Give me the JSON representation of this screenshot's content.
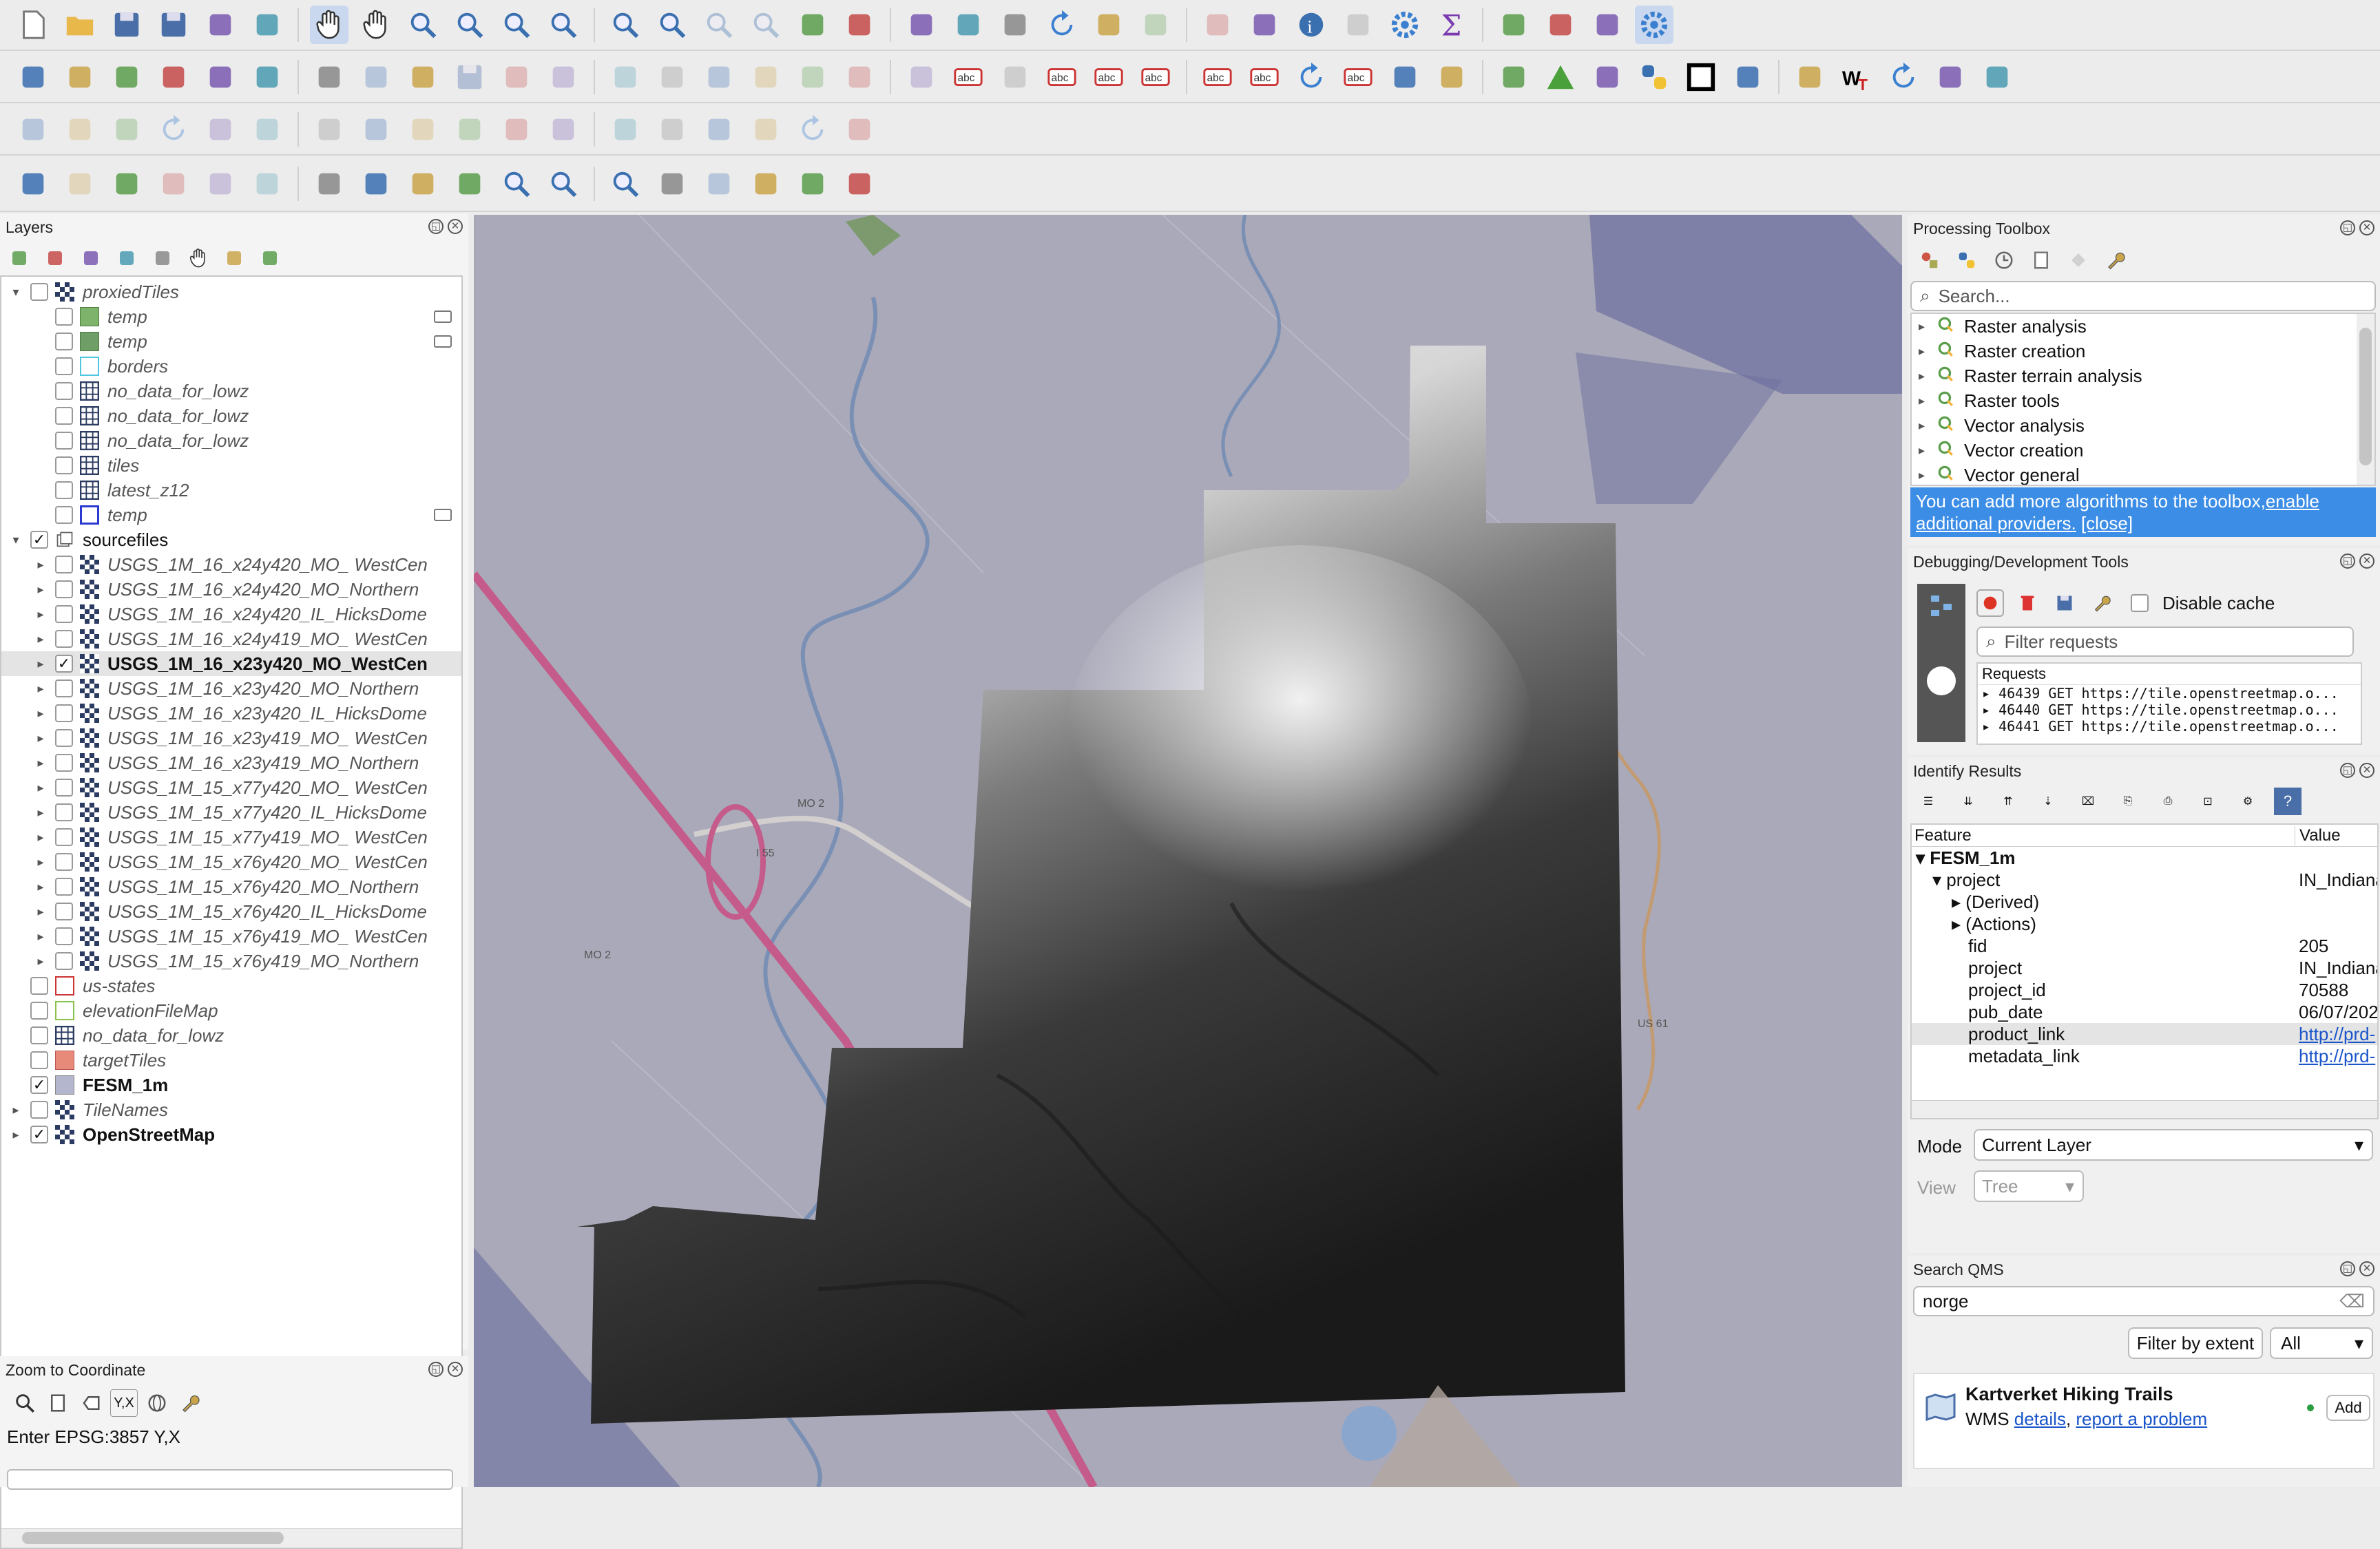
{
  "toolbars": {
    "row1": [
      "new-project-icon",
      "open-project-icon",
      "save-project-icon",
      "save-as-icon",
      "print-layout-icon",
      "style-manager-icon",
      "pan-icon",
      "pan-to-selection-icon",
      "zoom-in-icon",
      "zoom-out-icon",
      "zoom-full-icon",
      "zoom-to-selection-icon",
      "zoom-to-layer-icon",
      "zoom-native-icon",
      "zoom-last-icon",
      "zoom-next-icon",
      "new-map-view-icon",
      "new-3d-view-icon",
      "new-bookmark-icon",
      "show-bookmarks-icon",
      "temporal-controller-icon",
      "refresh-icon",
      "select-features-icon",
      "select-by-value-icon",
      "deselect-icon",
      "add-annotation-icon",
      "identify-icon",
      "attribute-table-icon",
      "processing-toolbox-icon",
      "statistics-icon",
      "field-calculator-icon",
      "measure-icon",
      "map-tips-icon",
      "settings-icon"
    ],
    "row2": [
      "data-source-manager-icon",
      "new-geopackage-icon",
      "add-vector-icon",
      "digitize-icon",
      "new-shapefile-icon",
      "add-raster-icon",
      "add-wms-icon",
      "current-edits-icon",
      "toggle-editing-icon",
      "save-edits-icon",
      "add-feature-icon",
      "vertex-tool-icon",
      "modify-attributes-icon",
      "delete-selected-icon",
      "cut-icon",
      "copy-icon",
      "paste-icon",
      "undo-icon",
      "redo-icon",
      "label-tool-icon",
      "diagram-icon",
      "layer-labeling-icon",
      "label-highlight-icon",
      "pin-label-icon",
      "show-hide-labels-icon",
      "move-label-icon",
      "rotate-label-icon",
      "change-label-icon",
      "georeferencer-icon",
      "quickmap-icon",
      "web-query-icon",
      "triangle-icon",
      "plugins-icon",
      "python-icon",
      "black-square-icon",
      "draw-icon",
      "globe-dark-icon",
      "wkt-icon",
      "rotate-icon",
      "grid-plugin-icon",
      "sliders-icon"
    ],
    "row3": [
      "measure-ruler-icon",
      "advanced-digitize-icon",
      "move-feature-icon",
      "rotate-feature-icon",
      "simplify-icon",
      "add-ring-icon",
      "add-part-icon",
      "fill-ring-icon",
      "delete-ring-icon",
      "delete-part-icon",
      "reshape-icon",
      "offset-curve-icon",
      "split-features-icon",
      "split-parts-icon",
      "merge-features-icon",
      "merge-attributes-icon",
      "rotate-symbols-icon",
      "text-curve-icon"
    ],
    "row4": [
      "snapping-icon",
      "tracing-icon",
      "add-coordinate-icon",
      "shapes-icon",
      "node-tool-icon",
      "select-tool-icon",
      "metadata-icon",
      "wrench-icon",
      "add-point-icon",
      "pin-icon",
      "zoom-point-icon",
      "zoom-pin-icon",
      "frame-zoom-icon",
      "globe-grid-icon",
      "xy-icon",
      "tools-icon",
      "qms-search-icon",
      "pencil-ruler-icon"
    ]
  },
  "layers_panel": {
    "title": "Layers",
    "toolbar": [
      "style-brush-icon",
      "add-group-icon",
      "visibility-eye-icon",
      "filter-icon",
      "expression-filter-icon",
      "expand-all-icon",
      "collapse-all-icon",
      "remove-layer-icon"
    ],
    "items": [
      {
        "name": "proxiedTiles",
        "indent": 0,
        "twisty": "▾",
        "checked": false,
        "icon": "raster",
        "style": "i"
      },
      {
        "name": "temp",
        "indent": 1,
        "twisty": "",
        "checked": false,
        "icon": "poly-green",
        "style": "i",
        "extra": true
      },
      {
        "name": "temp",
        "indent": 1,
        "twisty": "",
        "checked": false,
        "icon": "poly-green2",
        "style": "i",
        "extra": true
      },
      {
        "name": "borders",
        "indent": 1,
        "twisty": "",
        "checked": false,
        "icon": "poly-cyan",
        "style": "i"
      },
      {
        "name": "no_data_for_lowz",
        "indent": 1,
        "twisty": "",
        "checked": false,
        "icon": "grid",
        "style": "i"
      },
      {
        "name": "no_data_for_lowz",
        "indent": 1,
        "twisty": "",
        "checked": false,
        "icon": "grid",
        "style": "i"
      },
      {
        "name": "no_data_for_lowz",
        "indent": 1,
        "twisty": "",
        "checked": false,
        "icon": "grid",
        "style": "i"
      },
      {
        "name": "tiles",
        "indent": 1,
        "twisty": "",
        "checked": false,
        "icon": "grid",
        "style": "i"
      },
      {
        "name": "latest_z12",
        "indent": 1,
        "twisty": "",
        "checked": false,
        "icon": "grid",
        "style": "i"
      },
      {
        "name": "temp",
        "indent": 1,
        "twisty": "",
        "checked": false,
        "icon": "poly-blue",
        "style": "i",
        "extra": true
      },
      {
        "name": "sourcefiles",
        "indent": 0,
        "twisty": "▾",
        "checked": true,
        "icon": "group",
        "style": "n"
      },
      {
        "name": "USGS_1M_16_x24y420_MO_ WestCen",
        "indent": 1,
        "twisty": "▸",
        "checked": false,
        "icon": "raster",
        "style": "i"
      },
      {
        "name": "USGS_1M_16_x24y420_MO_Northern",
        "indent": 1,
        "twisty": "▸",
        "checked": false,
        "icon": "raster",
        "style": "i"
      },
      {
        "name": "USGS_1M_16_x24y420_IL_HicksDome",
        "indent": 1,
        "twisty": "▸",
        "checked": false,
        "icon": "raster",
        "style": "i"
      },
      {
        "name": "USGS_1M_16_x24y419_MO_ WestCen",
        "indent": 1,
        "twisty": "▸",
        "checked": false,
        "icon": "raster",
        "style": "i"
      },
      {
        "name": "USGS_1M_16_x23y420_MO_WestCen",
        "indent": 1,
        "twisty": "▸",
        "checked": true,
        "icon": "raster",
        "style": "b",
        "sel": true
      },
      {
        "name": "USGS_1M_16_x23y420_MO_Northern",
        "indent": 1,
        "twisty": "▸",
        "checked": false,
        "icon": "raster",
        "style": "i"
      },
      {
        "name": "USGS_1M_16_x23y420_IL_HicksDome",
        "indent": 1,
        "twisty": "▸",
        "checked": false,
        "icon": "raster",
        "style": "i"
      },
      {
        "name": "USGS_1M_16_x23y419_MO_ WestCen",
        "indent": 1,
        "twisty": "▸",
        "checked": false,
        "icon": "raster",
        "style": "i"
      },
      {
        "name": "USGS_1M_16_x23y419_MO_Northern",
        "indent": 1,
        "twisty": "▸",
        "checked": false,
        "icon": "raster",
        "style": "i"
      },
      {
        "name": "USGS_1M_15_x77y420_MO_ WestCen",
        "indent": 1,
        "twisty": "▸",
        "checked": false,
        "icon": "raster",
        "style": "i"
      },
      {
        "name": "USGS_1M_15_x77y420_IL_HicksDome",
        "indent": 1,
        "twisty": "▸",
        "checked": false,
        "icon": "raster",
        "style": "i"
      },
      {
        "name": "USGS_1M_15_x77y419_MO_ WestCen",
        "indent": 1,
        "twisty": "▸",
        "checked": false,
        "icon": "raster",
        "style": "i"
      },
      {
        "name": "USGS_1M_15_x76y420_MO_ WestCen",
        "indent": 1,
        "twisty": "▸",
        "checked": false,
        "icon": "raster",
        "style": "i"
      },
      {
        "name": "USGS_1M_15_x76y420_MO_Northern",
        "indent": 1,
        "twisty": "▸",
        "checked": false,
        "icon": "raster",
        "style": "i"
      },
      {
        "name": "USGS_1M_15_x76y420_IL_HicksDome",
        "indent": 1,
        "twisty": "▸",
        "checked": false,
        "icon": "raster",
        "style": "i"
      },
      {
        "name": "USGS_1M_15_x76y419_MO_ WestCen",
        "indent": 1,
        "twisty": "▸",
        "checked": false,
        "icon": "raster",
        "style": "i"
      },
      {
        "name": "USGS_1M_15_x76y419_MO_Northern",
        "indent": 1,
        "twisty": "▸",
        "checked": false,
        "icon": "raster",
        "style": "i"
      },
      {
        "name": "us-states",
        "indent": 0,
        "twisty": "",
        "checked": false,
        "icon": "poly-red",
        "style": "i"
      },
      {
        "name": "elevationFileMap",
        "indent": 0,
        "twisty": "",
        "checked": false,
        "icon": "poly-lime",
        "style": "i"
      },
      {
        "name": "no_data_for_lowz",
        "indent": 0,
        "twisty": "",
        "checked": false,
        "icon": "grid",
        "style": "i"
      },
      {
        "name": "targetTiles",
        "indent": 0,
        "twisty": "",
        "checked": false,
        "icon": "poly-salmon",
        "style": "i"
      },
      {
        "name": "FESM_1m",
        "indent": 0,
        "twisty": "",
        "checked": true,
        "icon": "poly-lav",
        "style": "b"
      },
      {
        "name": "TileNames",
        "indent": 0,
        "twisty": "▸",
        "checked": false,
        "icon": "raster",
        "style": "i"
      },
      {
        "name": "OpenStreetMap",
        "indent": 0,
        "twisty": "▸",
        "checked": true,
        "icon": "raster",
        "style": "b"
      }
    ]
  },
  "zoom_to_coordinate": {
    "title": "Zoom to Coordinate",
    "prompt": "Enter EPSG:3857 Y,X",
    "xy_label": "Y,X"
  },
  "map": {
    "labels": {
      "mo2_a": "MO 2",
      "mo2_b": "MO 2",
      "i55": "I 55",
      "us61": "US 61"
    }
  },
  "processing_toolbox": {
    "title": "Processing Toolbox",
    "search_placeholder": "Search...",
    "items": [
      "Raster analysis",
      "Raster creation",
      "Raster terrain analysis",
      "Raster tools",
      "Vector analysis",
      "Vector creation",
      "Vector general"
    ],
    "notice": "You can add more algorithms to the toolbox,",
    "notice_link": "enable additional providers.",
    "notice_close": "[close]"
  },
  "debug_tools": {
    "title": "Debugging/Development Tools",
    "disable_cache": "Disable cache",
    "filter_placeholder": "Filter requests",
    "requests_header": "Requests",
    "requests": [
      "46439 GET https://tile.openstreetmap.o...",
      "46440 GET https://tile.openstreetmap.o...",
      "46441 GET https://tile.openstreetmap.o..."
    ]
  },
  "identify_results": {
    "title": "Identify Results",
    "col_feature": "Feature",
    "col_value": "Value",
    "layer": "FESM_1m",
    "feature": "project",
    "feature_value": "IN_Indiana",
    "derived": "(Derived)",
    "actions": "(Actions)",
    "attributes": [
      {
        "k": "fid",
        "v": "205",
        "link": false
      },
      {
        "k": "project",
        "v": "IN_Indiana",
        "link": false
      },
      {
        "k": "project_id",
        "v": "70588",
        "link": false
      },
      {
        "k": "pub_date",
        "v": "06/07/202",
        "link": false
      },
      {
        "k": "product_link",
        "v": "http://prd-",
        "link": true
      },
      {
        "k": "metadata_link",
        "v": "http://prd-",
        "link": true
      }
    ],
    "mode_label": "Mode",
    "mode_value": "Current Layer",
    "view_label": "View",
    "view_value": "Tree"
  },
  "search_qms": {
    "title": "Search QMS",
    "query": "norge",
    "filter_btn": "Filter by extent",
    "filter_value": "All",
    "result_title": "Kartverket Hiking Trails",
    "result_type": "WMS",
    "result_details": "details",
    "result_report": "report a problem",
    "add_btn": "Add"
  }
}
